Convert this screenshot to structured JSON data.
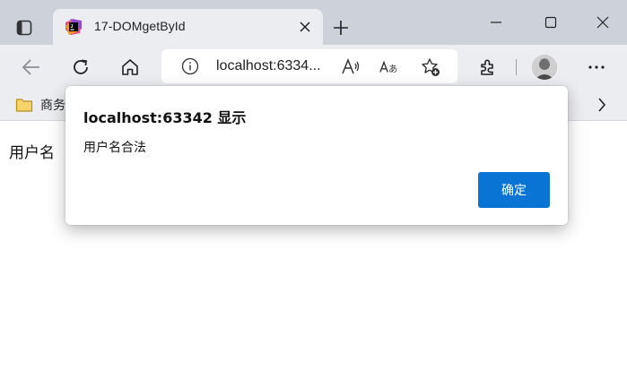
{
  "tab": {
    "title": "17-DOMgetById"
  },
  "address_bar": {
    "url": "localhost:6334..."
  },
  "favorites": {
    "folder_label": "商务"
  },
  "page": {
    "text": "用户名"
  },
  "dialog": {
    "title": "localhost:63342 显示",
    "message": "用户名合法",
    "ok_label": "确定"
  },
  "colors": {
    "accent": "#0a74d4",
    "tabstrip": "#cdd2da",
    "toolbar": "#ebedf0"
  },
  "icons": {
    "tab_actions": "tab-actions-icon",
    "favicon": "jetbrains-icon",
    "close": "close-icon",
    "new_tab": "plus-icon",
    "back": "back-arrow-icon",
    "refresh": "refresh-icon",
    "home": "home-icon",
    "info": "info-icon",
    "read_aloud": "read-aloud-icon",
    "translate": "translate-icon",
    "favorite_add": "star-add-icon",
    "extensions": "puzzle-icon",
    "more": "more-dots-icon",
    "folder": "folder-icon",
    "chevron": "chevron-right-icon"
  }
}
